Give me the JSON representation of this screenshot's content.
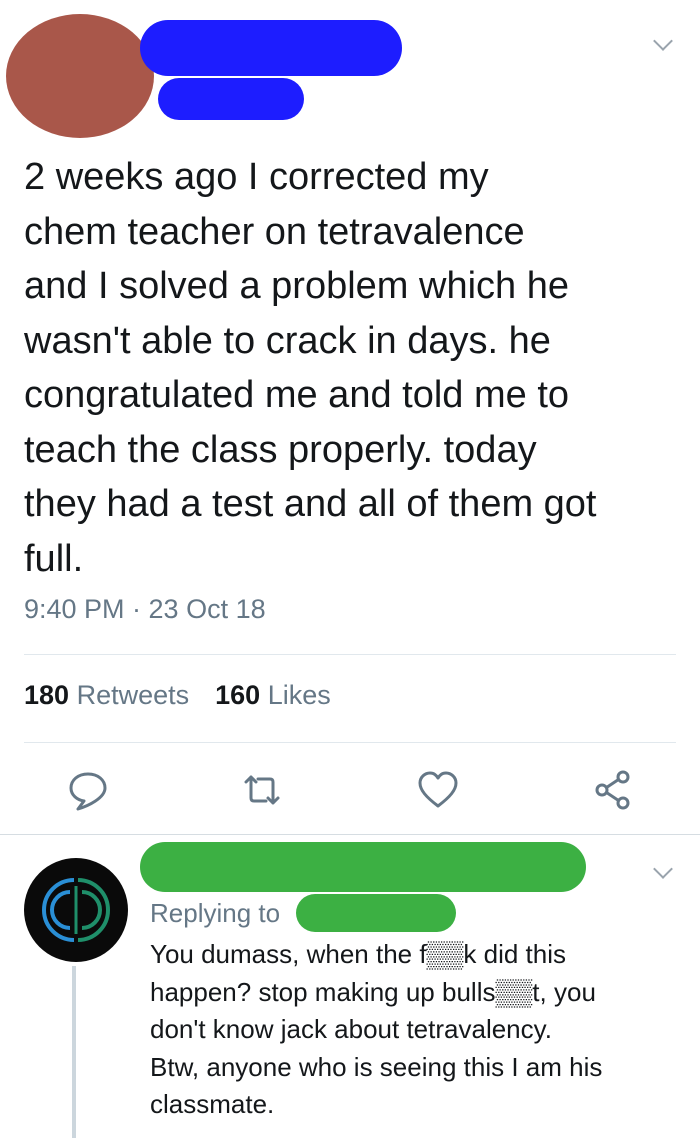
{
  "tweet": {
    "text": "2 weeks ago I corrected my\nchem teacher on tetravalence\nand I solved a problem which he\nwasn't able to crack in days. he\ncongratulated me and told me to\nteach the class properly. today\nthey had a test and all of them got\nfull.",
    "time": "9:40 PM · 23 Oct 18",
    "retweets_count": "180",
    "retweets_label": "Retweets",
    "likes_count": "160",
    "likes_label": "Likes"
  },
  "reply": {
    "replying_to": "Replying to",
    "text": "You dumass, when the f▒▒k did this\nhappen? stop making up bulls▒▒t, you\ndon't know jack about tetravalency.\nBtw, anyone who is seeing this I am his\nclassmate."
  },
  "colors": {
    "redact_avatar": "#a9574a",
    "redact_name_blue": "#1d1dff",
    "redact_name_green": "#3cb043",
    "text_primary": "#14171a",
    "text_secondary": "#657786",
    "icon": "#657786",
    "logo_green": "#1f8f6a",
    "logo_blue": "#2a8fd6"
  },
  "icons": [
    "chevron-down-icon",
    "reply-icon",
    "retweet-icon",
    "like-icon",
    "share-icon"
  ]
}
